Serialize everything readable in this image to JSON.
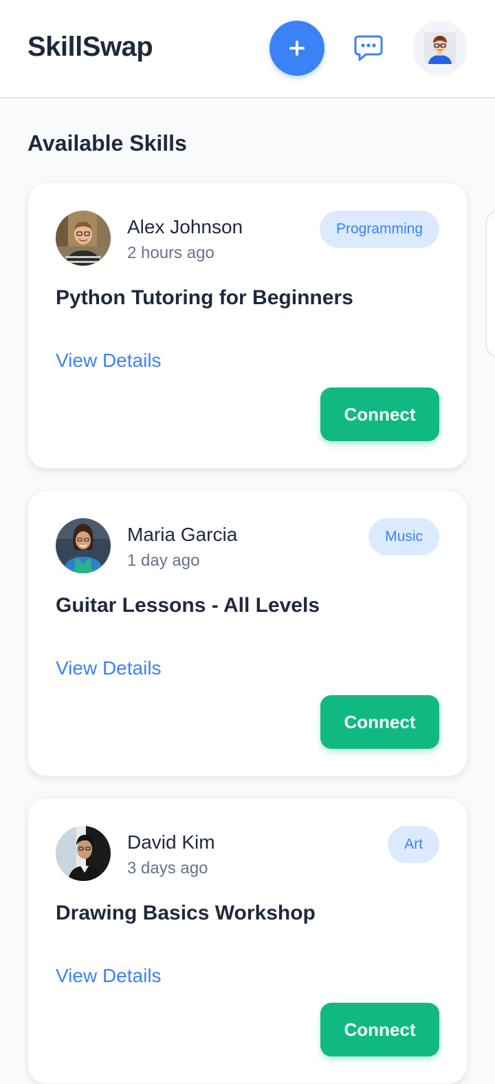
{
  "header": {
    "brand": "SkillSwap",
    "add_icon": "plus-icon",
    "messages_icon": "chat-bubble-icon",
    "profile_icon": "user-avatar-icon",
    "accent_color": "#3b82f6"
  },
  "main": {
    "section_title": "Available Skills",
    "cards": [
      {
        "author": "Alex Johnson",
        "time": "2 hours ago",
        "category": "Programming",
        "title": "Python Tutoring for Beginners",
        "details_label": "View Details",
        "connect_label": "Connect"
      },
      {
        "author": "Maria Garcia",
        "time": "1 day ago",
        "category": "Music",
        "title": "Guitar Lessons - All Levels",
        "details_label": "View Details",
        "connect_label": "Connect"
      },
      {
        "author": "David Kim",
        "time": "3 days ago",
        "category": "Art",
        "title": "Drawing Basics Workshop",
        "details_label": "View Details",
        "connect_label": "Connect"
      }
    ],
    "connect_color": "#10b981",
    "tag_bg_color": "#dbeafe"
  }
}
